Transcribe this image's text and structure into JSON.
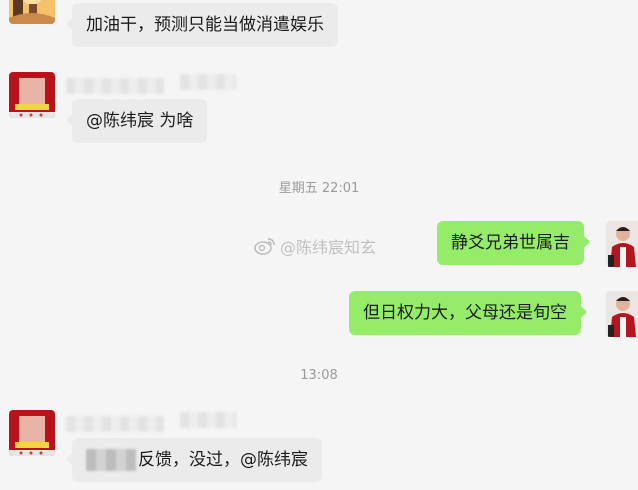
{
  "messages": [
    {
      "side": "left",
      "text": "加油干，预测只能当做消遣娱乐"
    },
    {
      "side": "left",
      "text": "@陈纬宸 为啥"
    },
    {
      "side": "right",
      "text": "静爻兄弟世属吉"
    },
    {
      "side": "right",
      "text": "但日权力大，父母还是旬空"
    },
    {
      "side": "left",
      "text": "反馈，没过，@陈纬宸"
    }
  ],
  "timestamps": [
    "星期五 22:01",
    "13:08"
  ],
  "watermark": "@陈纬宸知玄",
  "colors": {
    "background": "#f5f5f5",
    "bubble_incoming": "#ebebeb",
    "bubble_outgoing": "#95ec69",
    "timestamp_text": "#9b9b9b"
  },
  "icons": [
    "weibo-icon"
  ]
}
